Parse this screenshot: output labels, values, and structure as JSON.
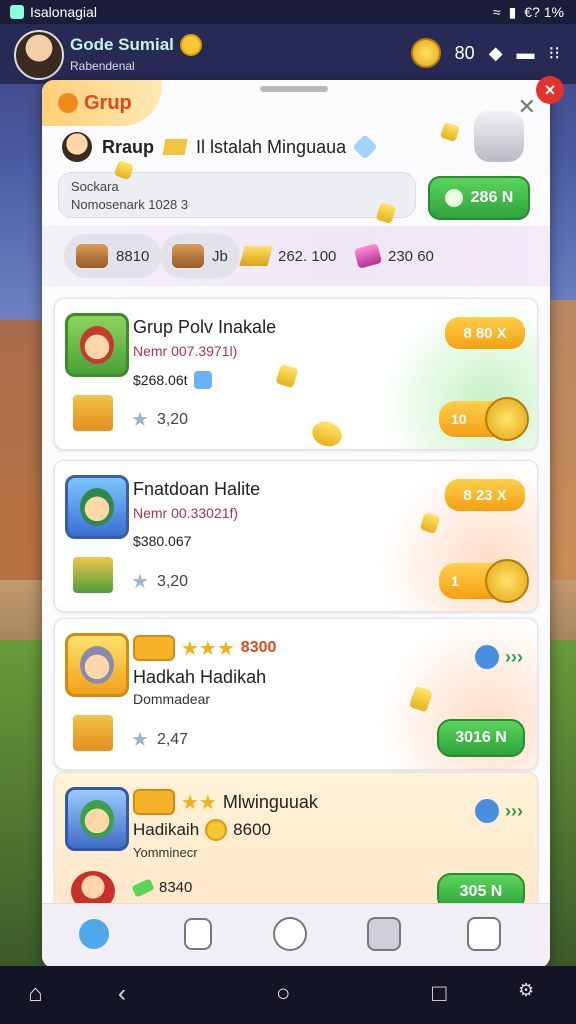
{
  "status": {
    "app_name": "Isalonagial",
    "right_text": "€? 1%"
  },
  "header": {
    "player_name": "Gode Sumial",
    "player_sub": "Rabendenal",
    "stat_value": "80"
  },
  "panel": {
    "group_label": "Grup",
    "sub_title_a": "Rraup",
    "sub_title_b": "Il lstalah Minguaua",
    "search_line1": "Sockara",
    "search_line2": "Nomosenark 1028 3",
    "action_value": "286 N",
    "resources": [
      {
        "value": "8810"
      },
      {
        "value": "Jb"
      },
      {
        "value": "262. 100"
      },
      {
        "value": "230 60"
      }
    ]
  },
  "cards": [
    {
      "title": "Grup Polv Inakale",
      "name": "Nemr 007.3971l)",
      "price": "$268.06t",
      "stars": "3,20",
      "chip_top": "8 80 X",
      "chip_btm": "10"
    },
    {
      "title": "Fnatdoan Halite",
      "name": "Nemr 00.33021f)",
      "price": "$380.067",
      "stars": "3,20",
      "chip_top": "8 23 X",
      "chip_btm": "1"
    },
    {
      "title": "Hadkah Hadikah",
      "name": "Dommadear",
      "price_top": "8300",
      "stars": "2,47",
      "chip": "3016 N"
    },
    {
      "title": "Mlwinguuak",
      "name": "Hadikaih",
      "price_coin": "8600",
      "sub": "Yomminecr",
      "price": "8340",
      "chip": "305 N"
    }
  ],
  "colors": {
    "accent_orange": "#f3a012",
    "accent_green": "#2da33a",
    "title_red": "#e0481c"
  },
  "icons": [
    "settings-icon",
    "news-icon",
    "chat-icon",
    "mailbox-icon",
    "share-icon",
    "home-icon",
    "back-icon",
    "circle-home-icon",
    "square-recents-icon",
    "gear-icon"
  ]
}
